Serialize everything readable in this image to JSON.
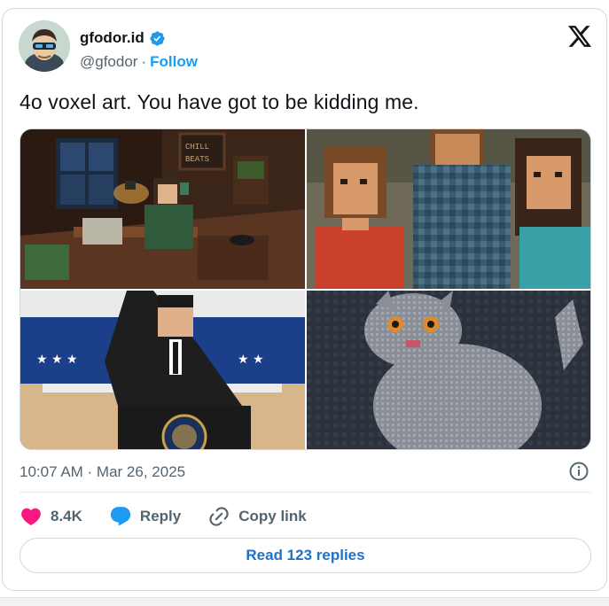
{
  "author": {
    "display_name": "gfodor.id",
    "handle": "@gfodor",
    "separator": "·",
    "follow_label": "Follow",
    "verified": true
  },
  "tweet": {
    "text": "4o voxel art. You have got to be kidding me.",
    "timestamp": "10:07 AM · Mar 26, 2025"
  },
  "media": [
    {
      "name": "voxel-lofi-room",
      "sign_text": "CHILL BEATS"
    },
    {
      "name": "voxel-people-crowd"
    },
    {
      "name": "voxel-podium-speaker"
    },
    {
      "name": "voxel-gray-cat"
    }
  ],
  "actions": {
    "like_count": "8.4K",
    "reply_label": "Reply",
    "copy_link_label": "Copy link"
  },
  "read_replies_label": "Read 123 replies",
  "colors": {
    "accent": "#1d9bf0",
    "like": "#f91880",
    "text_secondary": "#536471",
    "border": "#cfd9de"
  }
}
